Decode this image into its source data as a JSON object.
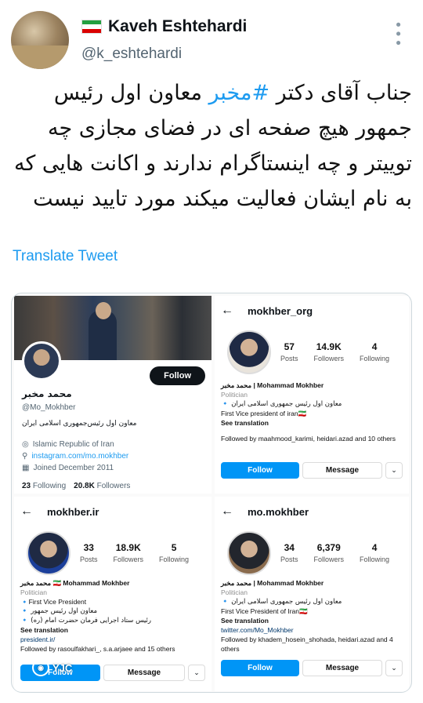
{
  "tweet": {
    "author_name": "Kaveh Eshtehardi",
    "handle": "@k_eshtehardi",
    "text_pre": "جناب آقای دکتر ",
    "hashtag": "#مخبر",
    "text_post": " معاون اول رئیس جمهور هیچ صفحه ای در فضای مجازی چه توییتر و چه اینستاگرام ندارند و اکانت هایی که به نام ایشان فعالیت میکند مورد تایید نیست",
    "translate_label": "Translate Tweet",
    "more_icon": "more-vertical-icon"
  },
  "colors": {
    "twitter_blue": "#1d9bf0",
    "instagram_blue": "#0095f6",
    "flag_green": "#239f40",
    "flag_red": "#da0000"
  },
  "twitter_profile": {
    "follow_label": "Follow",
    "name": "محمد مخبر",
    "handle": "@Mo_Mokhber",
    "bio": "معاون اول رئیس‌جمهوری اسلامی ایران",
    "location": "Islamic Republic of Iran",
    "link": "instagram.com/mo.mokhber",
    "joined": "Joined December 2011",
    "following_count": "23",
    "following_label": "Following",
    "followers_count": "20.8K",
    "followers_label": "Followers"
  },
  "ig_profiles": [
    {
      "username": "mokhber_org",
      "posts": "57",
      "followers": "14.9K",
      "following": "4",
      "posts_label": "Posts",
      "followers_label": "Followers",
      "following_label": "Following",
      "name_line": "محمد مخبر | Mohammad Mokhber",
      "category": "Politician",
      "bio_fa": "معاون اول رئیس جمهوری اسلامی ایران 🔹",
      "bio_en": "First Vice president of iran🇮🇷",
      "see_translation": "See translation",
      "followed_by": "Followed by maahmood_karimi, heidari.azad and 10 others",
      "follow_label": "Follow",
      "message_label": "Message"
    },
    {
      "username": "mokhber.ir",
      "posts": "33",
      "followers": "18.9K",
      "following": "5",
      "posts_label": "Posts",
      "followers_label": "Followers",
      "following_label": "Following",
      "name_line": "محمد مخبر 🇮🇷 Mohammad Mokhber",
      "category": "Politician",
      "bio_en": "🔹First Vice President",
      "bio_fa": "معاون اول رئیس جمهور 🔹",
      "bio_fa2": "رئیس ستاد اجرایی فرمان حضرت امام (ره) 🔹",
      "see_translation": "See translation",
      "link": "president.ir/",
      "followed_by": "Followed by rasoulfakhari_, s.a.arjaee and 15 others",
      "follow_label": "Follow",
      "message_label": "Message"
    },
    {
      "username": "mo.mokhber",
      "posts": "34",
      "followers": "6,379",
      "following": "4",
      "posts_label": "Posts",
      "followers_label": "Followers",
      "following_label": "Following",
      "name_line": "محمد مخبر | Mohammad Mokhber",
      "category": "Politician",
      "bio_fa": "معاون اول رئیس جمهوری اسلامی ایران 🔹",
      "bio_en": "First Vice President of Iran🇮🇷",
      "see_translation": "See translation",
      "link": "twitter.com/Mo_Mokhber",
      "followed_by": "Followed by khadem_hosein_shohada, heidari.azad and 4 others",
      "follow_label": "Follow",
      "message_label": "Message"
    }
  ],
  "watermark": "YJC"
}
